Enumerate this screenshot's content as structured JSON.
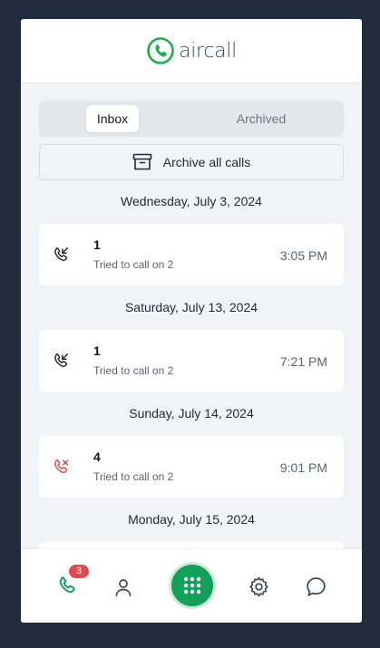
{
  "brand": {
    "name": "aircall",
    "accent": "#1bb24b"
  },
  "tabs": {
    "inbox": "Inbox",
    "archived": "Archived"
  },
  "archive_all_label": "Archive all calls",
  "calls": [
    {
      "date": "Wednesday, July 3, 2024",
      "name": "1",
      "description": "Tried to call on 2",
      "time": "3:05 PM",
      "type": "outgoing",
      "icon": "outgoing-call-icon"
    },
    {
      "date": "Saturday, July 13, 2024",
      "name": "1",
      "description": "Tried to call on 2",
      "time": "7:21 PM",
      "type": "outgoing",
      "icon": "outgoing-call-icon"
    },
    {
      "date": "Sunday, July 14, 2024",
      "name": "4",
      "description": "Tried to call on 2",
      "time": "9:01 PM",
      "type": "missed",
      "icon": "missed-call-icon"
    }
  ],
  "partial_date": "Monday, July 15, 2024",
  "nav": {
    "badge_count": "3",
    "items": [
      "phone-icon",
      "contacts-icon",
      "keypad-icon",
      "settings-icon",
      "chat-icon"
    ]
  },
  "colors": {
    "missed": "#e5484d",
    "nav_active": "#12a05a",
    "keypad_bg": "#12a05a"
  }
}
